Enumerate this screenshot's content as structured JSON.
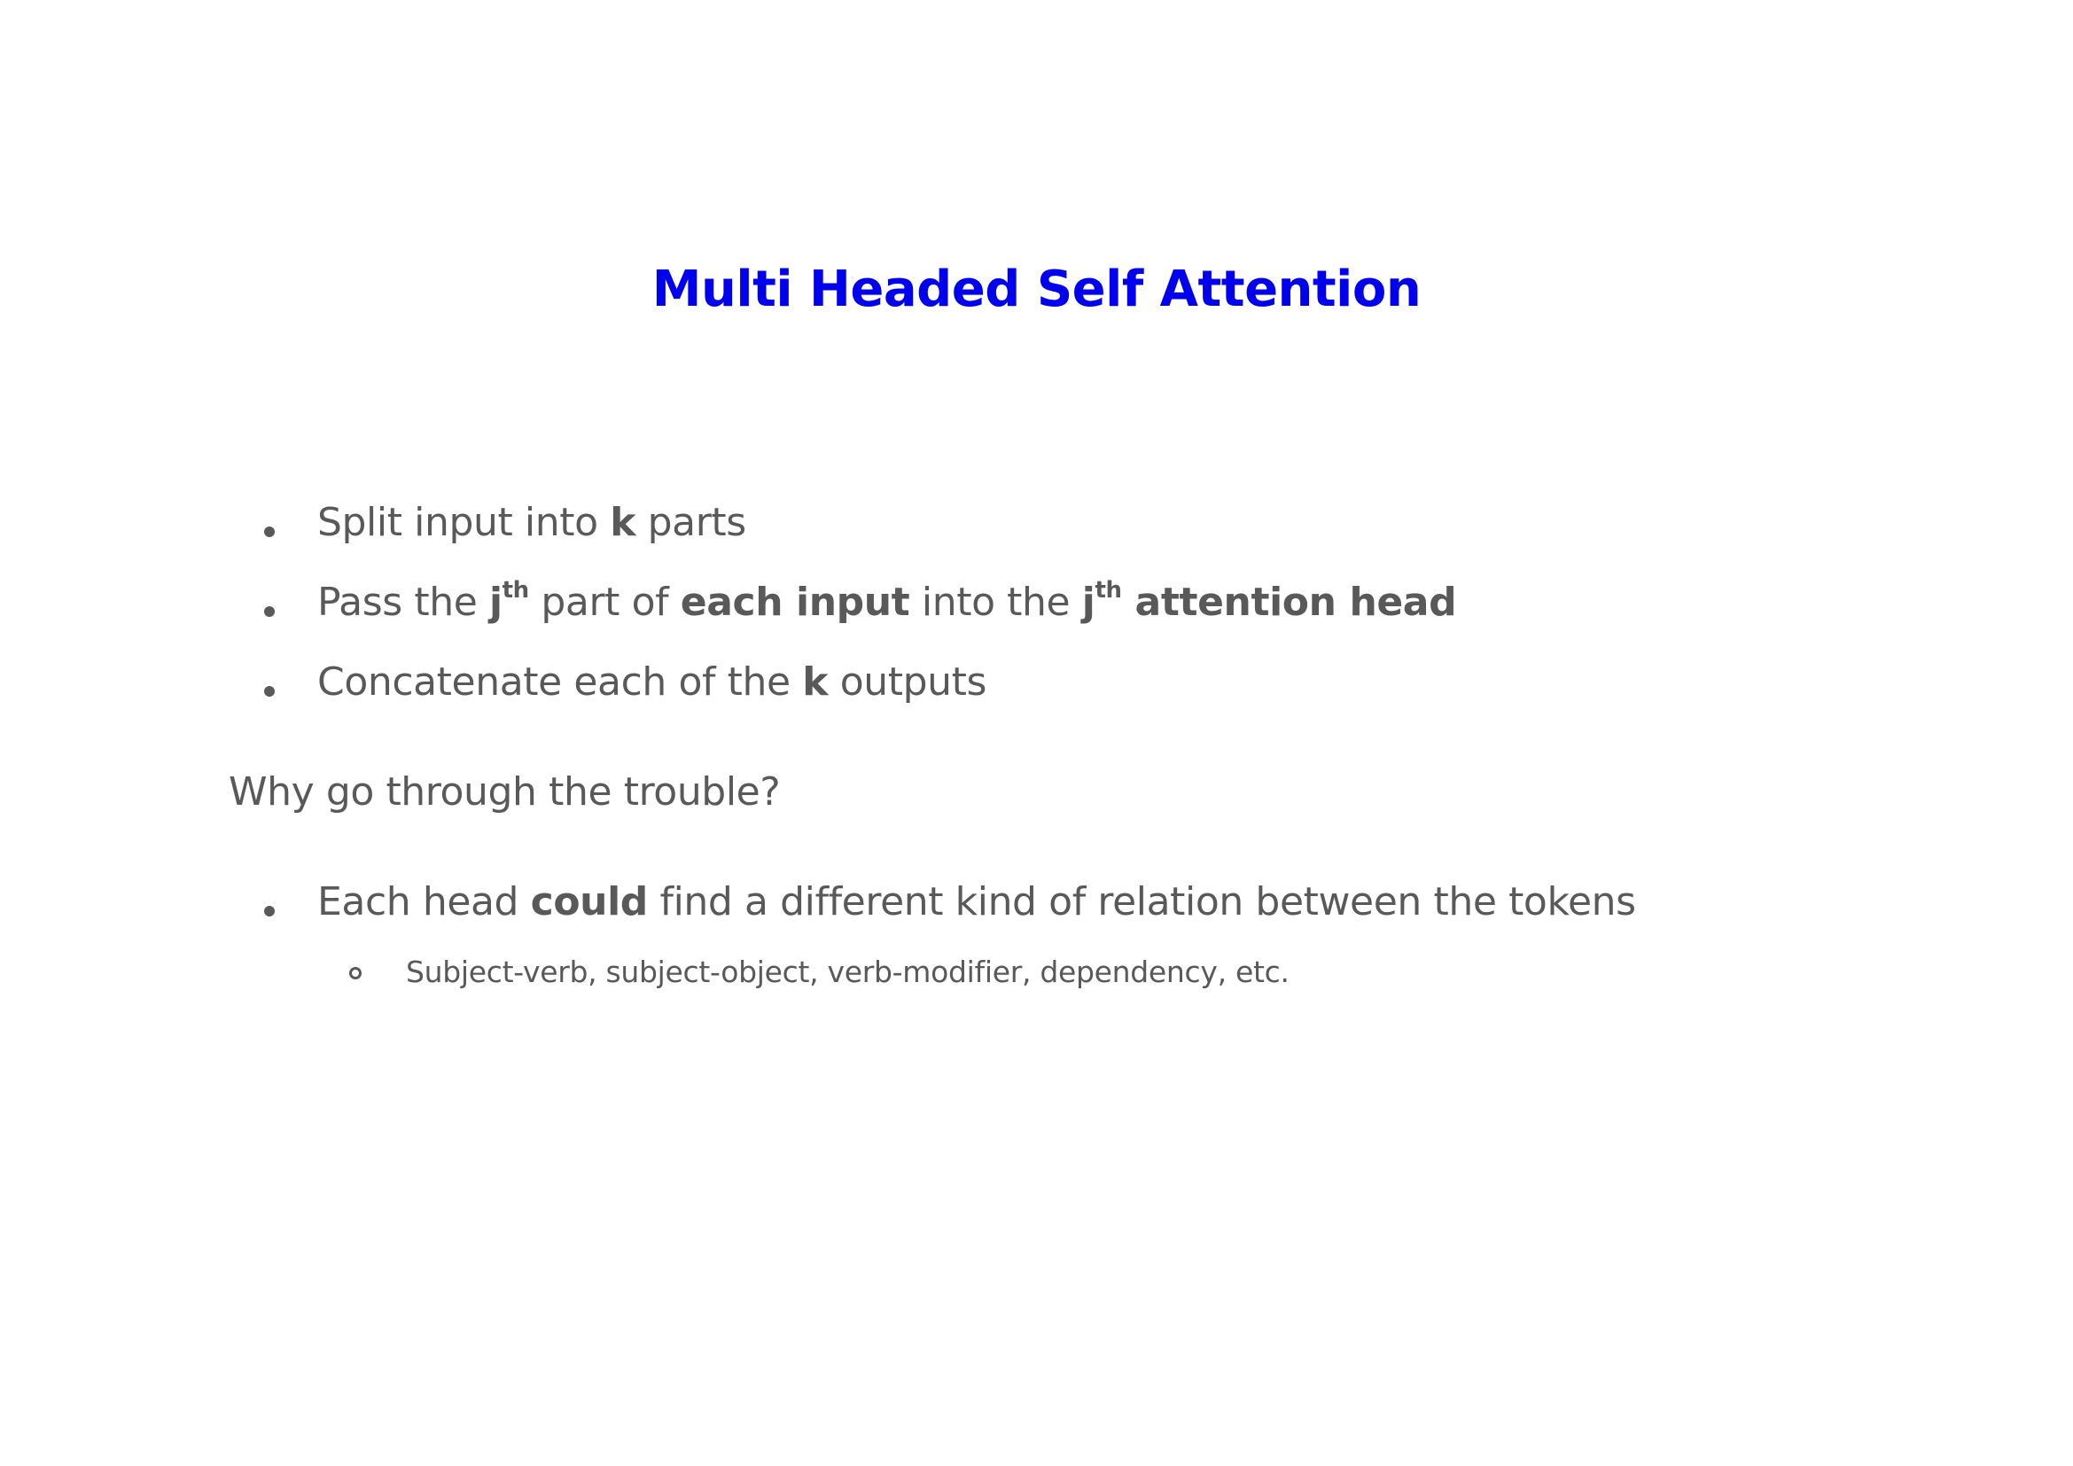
{
  "title": "Multi Headed Self Attention",
  "bullets": [
    {
      "parts": [
        "Split input into ",
        "k",
        " parts"
      ]
    },
    {
      "parts": [
        "Pass the ",
        "j",
        "th",
        " part of ",
        "each input",
        " into the ",
        "j",
        "th",
        " attention head"
      ]
    },
    {
      "parts": [
        "Concatenate each of the ",
        "k",
        " outputs"
      ]
    }
  ],
  "question": "Why go through the trouble?",
  "reason": {
    "parts": [
      "Each head ",
      "could",
      " find a different kind of relation between the tokens"
    ],
    "sub": "Subject-verb, subject-object, verb-modifier, dependency, etc."
  }
}
